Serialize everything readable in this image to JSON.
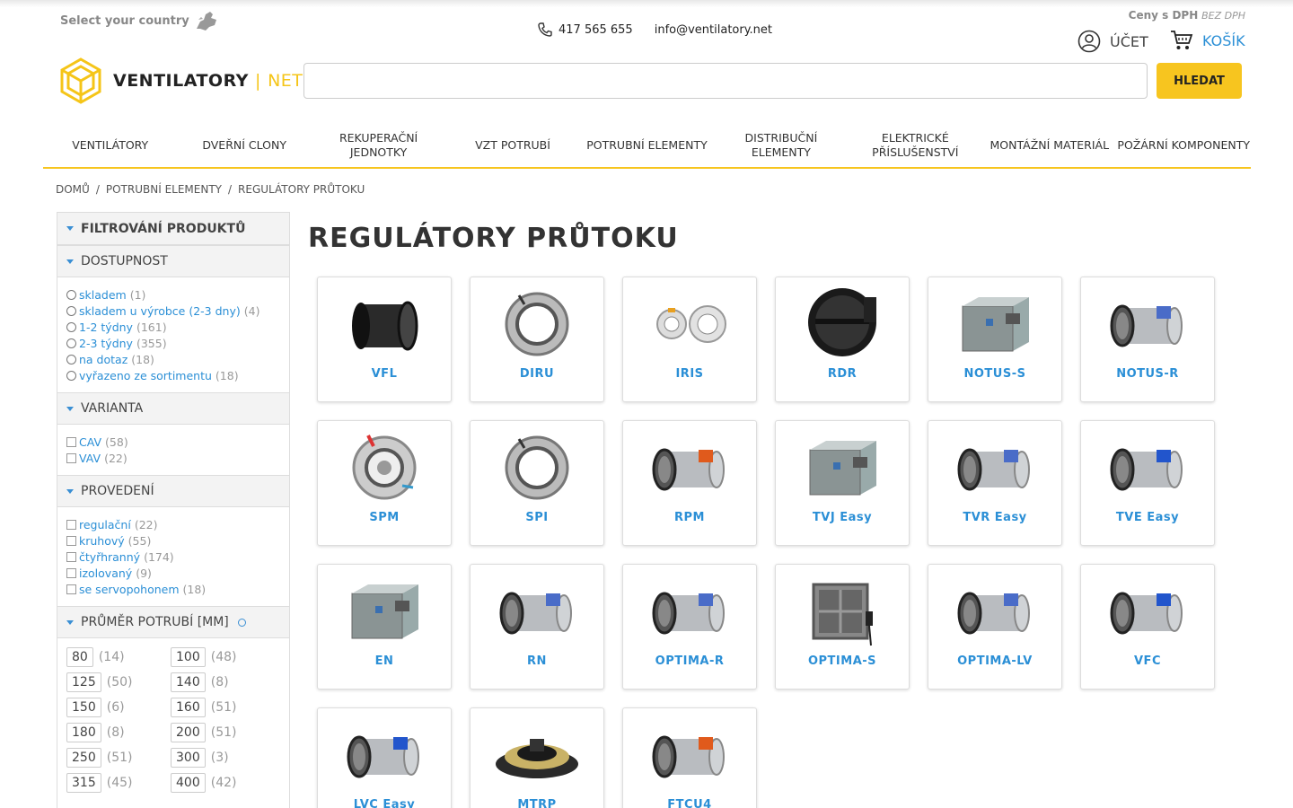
{
  "topbar": {
    "country": "Select your country",
    "phone": "417 565 655",
    "email": "info@ventilatory.net",
    "price_label": "Ceny s DPH",
    "price_alt": "BEZ DPH",
    "account": "ÚČET",
    "cart": "KOŠÍK"
  },
  "logo": {
    "main": "VENTILATORY",
    "sep": "|",
    "suffix": "NET"
  },
  "search": {
    "button": "HLEDAT",
    "placeholder": ""
  },
  "nav": [
    "VENTILÁTORY",
    "DVEŘNÍ CLONY",
    "REKUPERAČNÍ JEDNOTKY",
    "VZT POTRUBÍ",
    "POTRUBNÍ ELEMENTY",
    "DISTRIBUČNÍ ELEMENTY",
    "ELEKTRICKÉ PŘÍSLUŠENSTVÍ",
    "MONTÁŽNÍ MATERIÁL",
    "POŽÁRNÍ KOMPONENTY"
  ],
  "breadcrumb": [
    "DOMŮ",
    "/",
    "POTRUBNÍ ELEMENTY",
    "/",
    "REGULÁTORY PRŮTOKU"
  ],
  "sidebar": {
    "filter_title": "FILTROVÁNÍ PRODUKTŮ",
    "availability": {
      "title": "DOSTUPNOST",
      "options": [
        {
          "label": "skladem",
          "count": "(1)"
        },
        {
          "label": "skladem u výrobce (2-3 dny)",
          "count": "(4)"
        },
        {
          "label": "1-2 týdny",
          "count": "(161)"
        },
        {
          "label": "2-3 týdny",
          "count": "(355)"
        },
        {
          "label": "na dotaz",
          "count": "(18)"
        },
        {
          "label": "vyřazeno ze sortimentu",
          "count": "(18)"
        }
      ]
    },
    "variant": {
      "title": "VARIANTA",
      "options": [
        {
          "label": "CAV",
          "count": "(58)"
        },
        {
          "label": "VAV",
          "count": "(22)"
        }
      ]
    },
    "design": {
      "title": "PROVEDENÍ",
      "options": [
        {
          "label": "regulační",
          "count": "(22)"
        },
        {
          "label": "kruhový",
          "count": "(55)"
        },
        {
          "label": "čtyřhranný",
          "count": "(174)"
        },
        {
          "label": "izolovaný",
          "count": "(9)"
        },
        {
          "label": "se servopohonem",
          "count": "(18)"
        }
      ]
    },
    "diameter": {
      "title": "PRŮMĚR POTRUBÍ [MM]",
      "options": [
        {
          "v": "80",
          "c": "(14)"
        },
        {
          "v": "100",
          "c": "(48)"
        },
        {
          "v": "125",
          "c": "(50)"
        },
        {
          "v": "140",
          "c": "(8)"
        },
        {
          "v": "150",
          "c": "(6)"
        },
        {
          "v": "160",
          "c": "(51)"
        },
        {
          "v": "180",
          "c": "(8)"
        },
        {
          "v": "200",
          "c": "(51)"
        },
        {
          "v": "250",
          "c": "(51)"
        },
        {
          "v": "300",
          "c": "(3)"
        },
        {
          "v": "315",
          "c": "(45)"
        },
        {
          "v": "400",
          "c": "(42)"
        }
      ]
    }
  },
  "main": {
    "title": "REGULÁTORY PRŮTOKU",
    "products": [
      {
        "name": "VFL",
        "shape": "round-dark"
      },
      {
        "name": "DIRU",
        "shape": "ring"
      },
      {
        "name": "IRIS",
        "shape": "iris"
      },
      {
        "name": "RDR",
        "shape": "round-black"
      },
      {
        "name": "NOTUS-S",
        "shape": "box"
      },
      {
        "name": "NOTUS-R",
        "shape": "tube"
      },
      {
        "name": "SPM",
        "shape": "ring-red"
      },
      {
        "name": "SPI",
        "shape": "ring"
      },
      {
        "name": "RPM",
        "shape": "tube-orange"
      },
      {
        "name": "TVJ Easy",
        "shape": "box"
      },
      {
        "name": "TVR Easy",
        "shape": "tube"
      },
      {
        "name": "TVE Easy",
        "shape": "tube-blue"
      },
      {
        "name": "EN",
        "shape": "box"
      },
      {
        "name": "RN",
        "shape": "tube"
      },
      {
        "name": "OPTIMA-R",
        "shape": "tube"
      },
      {
        "name": "OPTIMA-S",
        "shape": "box-square"
      },
      {
        "name": "OPTIMA-LV",
        "shape": "tube"
      },
      {
        "name": "VFC",
        "shape": "tube-blue"
      },
      {
        "name": "LVC Easy",
        "shape": "tube-blue"
      },
      {
        "name": "MTRP",
        "shape": "round-yellow"
      },
      {
        "name": "FTCU4",
        "shape": "tube-orange"
      }
    ]
  }
}
